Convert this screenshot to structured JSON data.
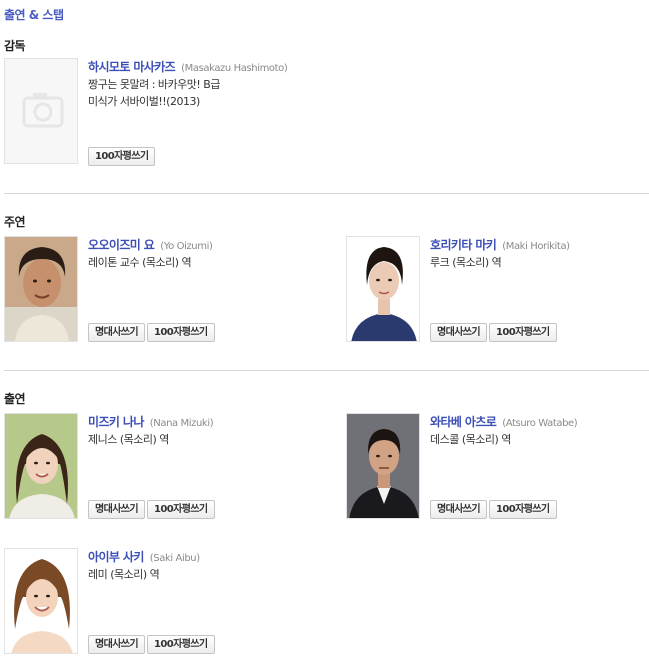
{
  "page": {
    "title": "출연 & 스탭"
  },
  "sections": {
    "director": "감독",
    "lead": "주연",
    "cast": "출연"
  },
  "buttons": {
    "quote": "명대사쓰기",
    "review": "100자평쓰기"
  },
  "people": {
    "hashimoto": {
      "name": "하시모토 마사카즈",
      "ename": "(Masakazu Hashimoto)",
      "role1": "짱구는 못말려 : 바카우맛! B급",
      "role2": "미식가 서바이벌!!(2013)"
    },
    "oizumi": {
      "name": "오오이즈미 요",
      "ename": "(Yo Oizumi)",
      "role1": "레이톤 교수 (목소리) 역"
    },
    "horikita": {
      "name": "호리키타 마키",
      "ename": "(Maki Horikita)",
      "role1": "루크 (목소리) 역"
    },
    "mizuki": {
      "name": "미즈키 나나",
      "ename": "(Nana Mizuki)",
      "role1": "제니스 (목소리) 역"
    },
    "watabe": {
      "name": "와타베 아츠로",
      "ename": "(Atsuro Watabe)",
      "role1": "데스콜 (목소리) 역"
    },
    "aibu": {
      "name": "아이부 사키",
      "ename": "(Saki Aibu)",
      "role1": "레미 (목소리) 역"
    }
  },
  "colors": {
    "accent": "#3c4fb7",
    "title": "#4a5bc4"
  }
}
